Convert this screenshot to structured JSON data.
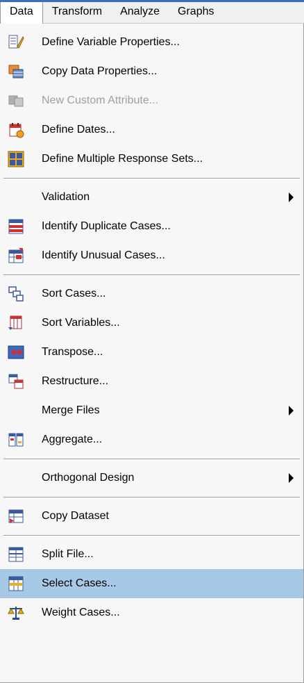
{
  "menubar": {
    "items": [
      "Data",
      "Transform",
      "Analyze",
      "Graphs"
    ]
  },
  "menu": {
    "define_variable_properties": "Define Variable Properties...",
    "copy_data_properties": "Copy Data Properties...",
    "new_custom_attribute": "New Custom Attribute...",
    "define_dates": "Define Dates...",
    "define_multiple_response_sets": "Define Multiple Response Sets...",
    "validation": "Validation",
    "identify_duplicate_cases": "Identify Duplicate Cases...",
    "identify_unusual_cases": "Identify Unusual Cases...",
    "sort_cases": "Sort Cases...",
    "sort_variables": "Sort Variables...",
    "transpose": "Transpose...",
    "restructure": "Restructure...",
    "merge_files": "Merge Files",
    "aggregate": "Aggregate...",
    "orthogonal_design": "Orthogonal Design",
    "copy_dataset": "Copy Dataset",
    "split_file": "Split File...",
    "select_cases": "Select Cases...",
    "weight_cases": "Weight Cases..."
  },
  "icons": {
    "define_variable_properties": "variable-properties-icon",
    "copy_data_properties": "copy-properties-icon",
    "new_custom_attribute": "custom-attribute-icon",
    "define_dates": "calendar-icon",
    "define_multiple_response_sets": "response-sets-icon",
    "identify_duplicate_cases": "duplicate-cases-icon",
    "identify_unusual_cases": "unusual-cases-icon",
    "sort_cases": "sort-cases-icon",
    "sort_variables": "sort-variables-icon",
    "transpose": "transpose-icon",
    "restructure": "restructure-icon",
    "aggregate": "aggregate-icon",
    "copy_dataset": "copy-dataset-icon",
    "split_file": "split-file-icon",
    "select_cases": "select-cases-icon",
    "weight_cases": "weight-scale-icon"
  },
  "colors": {
    "highlight": "#a8c8e8",
    "disabled_text": "#a0a0a0",
    "menubar_accent": "#3a6bc6"
  },
  "state": {
    "open_menu": "Data",
    "highlighted_item": "Select Cases...",
    "disabled_items": [
      "New Custom Attribute..."
    ]
  }
}
